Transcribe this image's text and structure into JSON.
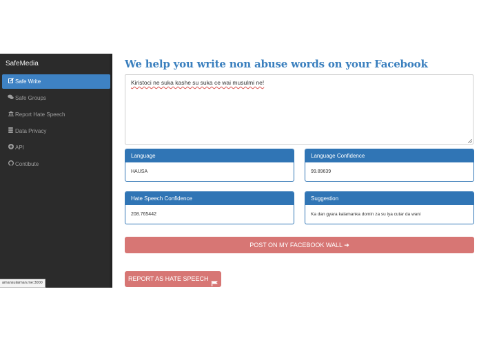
{
  "sidebar": {
    "brand": "SafeMedia",
    "items": [
      {
        "label": "Safe Write",
        "icon": "edit-icon",
        "active": true
      },
      {
        "label": "Safe Groups",
        "icon": "comments-icon",
        "active": false
      },
      {
        "label": "Report Hate Speech",
        "icon": "bank-icon",
        "active": false
      },
      {
        "label": "Data Privacy",
        "icon": "database-icon",
        "active": false
      },
      {
        "label": "API",
        "icon": "circle-plus-icon",
        "active": false
      },
      {
        "label": "Contibute",
        "icon": "github-icon",
        "active": false
      }
    ]
  },
  "status_tooltip": "amansulaiman.me:3000",
  "main": {
    "title": "We help you write non abuse words on your Facebook",
    "editor_text": "Kiristoci ne suka kashe su suka ce wai musulmi ne!",
    "panels": {
      "language": {
        "label": "Language",
        "value": "HAUSA"
      },
      "language_confidence": {
        "label": "Language Confidence",
        "value": "99.89639"
      },
      "hate_speech_confidence": {
        "label": "Hate Speech Confidence",
        "value": "208.765442"
      },
      "suggestion": {
        "label": "Suggestion",
        "value": "Ka dan gyara kalamanka domin za su iya cutar da wani"
      }
    },
    "post_button": "POST ON MY FACEBOOK WALL",
    "post_arrow": "➔",
    "report_button": "REPORT AS HATE SPEECH"
  },
  "colors": {
    "accent": "#3e82c4",
    "panel_header": "#3075b5",
    "title": "#3a7fbe",
    "danger_button": "#d77674",
    "sidebar_bg": "#2b2b2b"
  }
}
